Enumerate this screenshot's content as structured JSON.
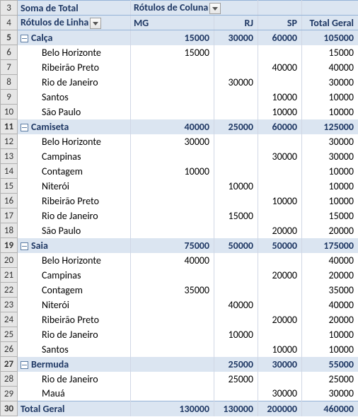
{
  "header": {
    "measure_label": "Soma de Total",
    "col_labels_caption": "Rótulos de Coluna",
    "row_labels_caption": "Rótulos de Linha",
    "columns": [
      "MG",
      "RJ",
      "SP"
    ],
    "grand_total_label": "Total Geral"
  },
  "row_start": 3,
  "groups": [
    {
      "name": "Calça",
      "MG": "15000",
      "RJ": "30000",
      "SP": "60000",
      "total": "105000",
      "rows": [
        {
          "name": "Belo Horizonte",
          "MG": "15000",
          "RJ": "",
          "SP": "",
          "total": "15000"
        },
        {
          "name": "Ribeirão Preto",
          "MG": "",
          "RJ": "",
          "SP": "40000",
          "total": "40000"
        },
        {
          "name": "Rio de Janeiro",
          "MG": "",
          "RJ": "30000",
          "SP": "",
          "total": "30000"
        },
        {
          "name": "Santos",
          "MG": "",
          "RJ": "",
          "SP": "10000",
          "total": "10000"
        },
        {
          "name": "São Paulo",
          "MG": "",
          "RJ": "",
          "SP": "10000",
          "total": "10000"
        }
      ]
    },
    {
      "name": "Camiseta",
      "MG": "40000",
      "RJ": "25000",
      "SP": "60000",
      "total": "125000",
      "rows": [
        {
          "name": "Belo Horizonte",
          "MG": "30000",
          "RJ": "",
          "SP": "",
          "total": "30000"
        },
        {
          "name": "Campinas",
          "MG": "",
          "RJ": "",
          "SP": "30000",
          "total": "30000"
        },
        {
          "name": "Contagem",
          "MG": "10000",
          "RJ": "",
          "SP": "",
          "total": "10000"
        },
        {
          "name": "Niterói",
          "MG": "",
          "RJ": "10000",
          "SP": "",
          "total": "10000"
        },
        {
          "name": "Ribeirão Preto",
          "MG": "",
          "RJ": "",
          "SP": "10000",
          "total": "10000"
        },
        {
          "name": "Rio de Janeiro",
          "MG": "",
          "RJ": "15000",
          "SP": "",
          "total": "15000"
        },
        {
          "name": "São Paulo",
          "MG": "",
          "RJ": "",
          "SP": "20000",
          "total": "20000"
        }
      ]
    },
    {
      "name": "Saia",
      "MG": "75000",
      "RJ": "50000",
      "SP": "50000",
      "total": "175000",
      "rows": [
        {
          "name": "Belo Horizonte",
          "MG": "40000",
          "RJ": "",
          "SP": "",
          "total": "40000"
        },
        {
          "name": "Campinas",
          "MG": "",
          "RJ": "",
          "SP": "20000",
          "total": "20000"
        },
        {
          "name": "Contagem",
          "MG": "35000",
          "RJ": "",
          "SP": "",
          "total": "35000"
        },
        {
          "name": "Niterói",
          "MG": "",
          "RJ": "40000",
          "SP": "",
          "total": "40000"
        },
        {
          "name": "Ribeirão Preto",
          "MG": "",
          "RJ": "",
          "SP": "20000",
          "total": "20000"
        },
        {
          "name": "Rio de Janeiro",
          "MG": "",
          "RJ": "10000",
          "SP": "",
          "total": "10000"
        },
        {
          "name": "Santos",
          "MG": "",
          "RJ": "",
          "SP": "10000",
          "total": "10000"
        }
      ]
    },
    {
      "name": "Bermuda",
      "MG": "",
      "RJ": "25000",
      "SP": "30000",
      "total": "55000",
      "rows": [
        {
          "name": "Rio de Janeiro",
          "MG": "",
          "RJ": "25000",
          "SP": "",
          "total": "25000"
        },
        {
          "name": "Mauá",
          "MG": "",
          "RJ": "",
          "SP": "30000",
          "total": "30000"
        }
      ]
    }
  ],
  "grand_total": {
    "MG": "130000",
    "RJ": "130000",
    "SP": "200000",
    "total": "460000"
  }
}
